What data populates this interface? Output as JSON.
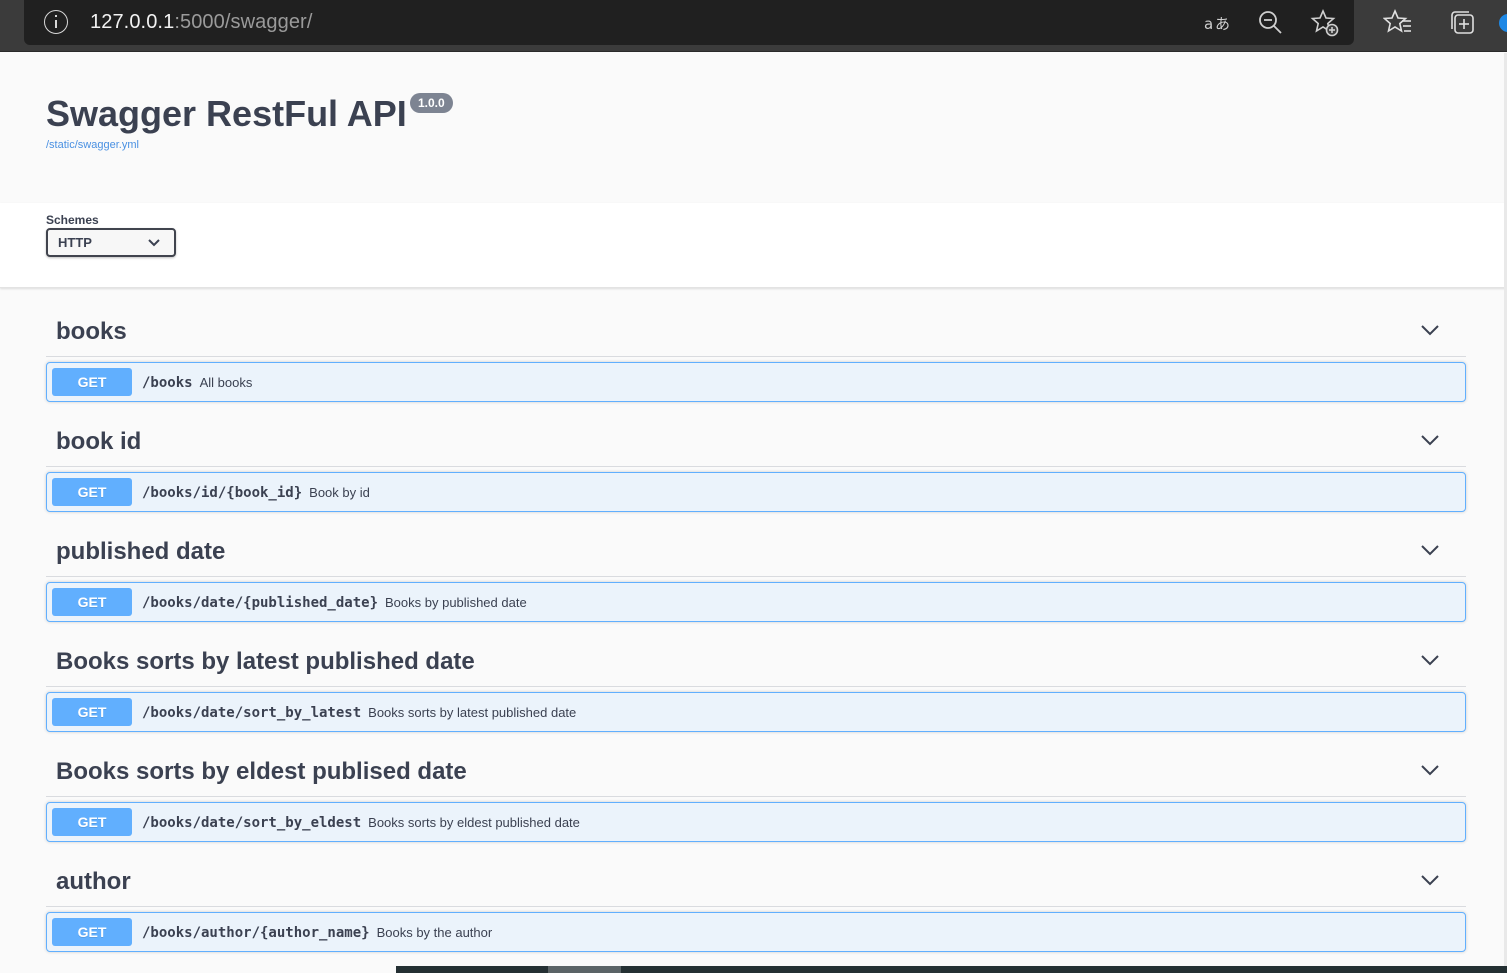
{
  "browser": {
    "url_host": "127.0.0.1",
    "url_rest": ":5000/swagger/",
    "icons": [
      "info-icon",
      "read-aloud-icon",
      "zoom-out-icon",
      "add-favorite-icon",
      "favorites-icon",
      "collections-icon",
      "profile-icon"
    ]
  },
  "info": {
    "title": "Swagger RestFul API",
    "version": "1.0.0",
    "spec_url": "/static/swagger.yml"
  },
  "schemes": {
    "label": "Schemes",
    "selected": "HTTP"
  },
  "colors": {
    "get_method": "#61affe",
    "get_background": "#ebf3fb",
    "title_text": "#3b4151",
    "link": "#4990e2",
    "version_badge": "#7d8492"
  },
  "tags": [
    {
      "name": "books",
      "operations": [
        {
          "method": "GET",
          "path": "/books",
          "summary": "All books"
        }
      ]
    },
    {
      "name": "book id",
      "operations": [
        {
          "method": "GET",
          "path": "/books/id/{book_id}",
          "summary": "Book by id"
        }
      ]
    },
    {
      "name": "published date",
      "operations": [
        {
          "method": "GET",
          "path": "/books/date/{published_date}",
          "summary": "Books by published date"
        }
      ]
    },
    {
      "name": "Books sorts by latest published date",
      "operations": [
        {
          "method": "GET",
          "path": "/books/date/sort_by_latest",
          "summary": "Books sorts by latest published date"
        }
      ]
    },
    {
      "name": "Books sorts by eldest publised date",
      "operations": [
        {
          "method": "GET",
          "path": "/books/date/sort_by_eldest",
          "summary": "Books sorts by eldest published date"
        }
      ]
    },
    {
      "name": "author",
      "operations": [
        {
          "method": "GET",
          "path": "/books/author/{author_name}",
          "summary": "Books by the author"
        }
      ]
    }
  ]
}
